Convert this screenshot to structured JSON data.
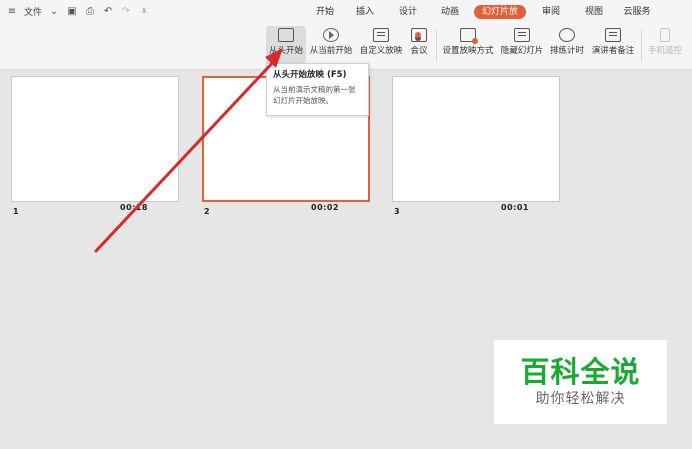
{
  "titlebar": {
    "file_menu": "文件",
    "tabs": [
      {
        "label": "开始"
      },
      {
        "label": "插入"
      },
      {
        "label": "设计"
      },
      {
        "label": "动画"
      },
      {
        "label": "幻灯片放映"
      },
      {
        "label": "审阅"
      },
      {
        "label": "视图"
      },
      {
        "label": "云服务"
      }
    ],
    "active_tab": "幻灯片放映"
  },
  "ribbon": {
    "buttons": [
      {
        "label": "从头开始",
        "icon": "screen-icon"
      },
      {
        "label": "从当前开始",
        "icon": "play-circle-icon"
      },
      {
        "label": "自定义放映",
        "icon": "custom-show-icon"
      },
      {
        "label": "会议",
        "icon": "meeting-icon"
      },
      {
        "label": "设置放映方式",
        "icon": "settings-screen-icon"
      },
      {
        "label": "隐藏幻灯片",
        "icon": "hide-slide-icon"
      },
      {
        "label": "排练计时",
        "icon": "stopwatch-icon"
      },
      {
        "label": "演讲者备注",
        "icon": "notes-icon"
      },
      {
        "label": "手机遥控",
        "icon": "phone-icon"
      }
    ]
  },
  "tooltip": {
    "title": "从头开始放映 (F5)",
    "body": "从当前演示文稿的第一张幻灯片开始放映。"
  },
  "slides": [
    {
      "number": "1",
      "time": "00:18"
    },
    {
      "number": "2",
      "time": "00:02"
    },
    {
      "number": "3",
      "time": "00:01"
    }
  ],
  "watermark": {
    "main": "百科全说",
    "sub": "助你轻松解决"
  },
  "colors": {
    "accent": "#e2603a",
    "arrow": "#d9282f",
    "watermark_green": "#1aaa33"
  }
}
